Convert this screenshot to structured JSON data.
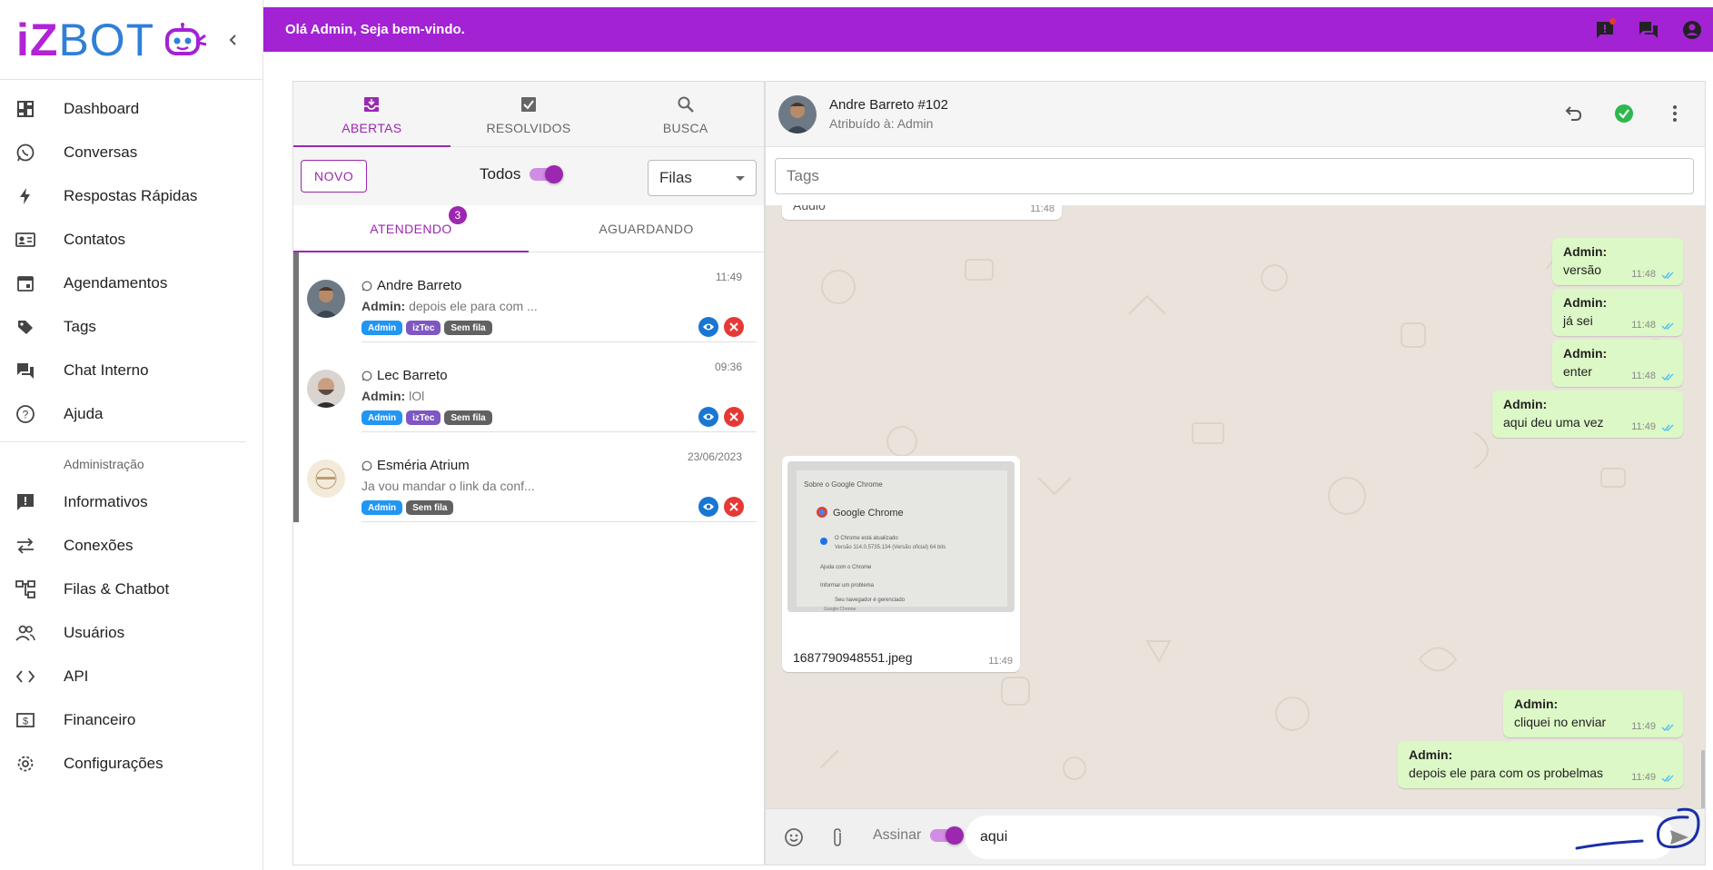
{
  "brand": {
    "part1": "iZ",
    "part2": "BOT"
  },
  "sidebar": {
    "items": [
      {
        "label": "Dashboard",
        "icon": "dashboard-icon"
      },
      {
        "label": "Conversas",
        "icon": "whatsapp-icon"
      },
      {
        "label": "Respostas Rápidas",
        "icon": "bolt-icon"
      },
      {
        "label": "Contatos",
        "icon": "contacts-icon"
      },
      {
        "label": "Agendamentos",
        "icon": "calendar-icon"
      },
      {
        "label": "Tags",
        "icon": "tag-icon"
      },
      {
        "label": "Chat Interno",
        "icon": "forum-icon"
      },
      {
        "label": "Ajuda",
        "icon": "help-icon"
      }
    ],
    "section_label": "Administração",
    "admin_items": [
      {
        "label": "Informativos",
        "icon": "announcement-icon"
      },
      {
        "label": "Conexões",
        "icon": "swap-icon"
      },
      {
        "label": "Filas & Chatbot",
        "icon": "account-tree-icon"
      },
      {
        "label": "Usuários",
        "icon": "people-icon"
      },
      {
        "label": "API",
        "icon": "code-icon"
      },
      {
        "label": "Financeiro",
        "icon": "money-icon"
      },
      {
        "label": "Configurações",
        "icon": "settings-icon"
      }
    ]
  },
  "topbar": {
    "welcome": "Olá Admin, Seja bem-vindo."
  },
  "tickets": {
    "tabs": [
      {
        "label": "ABERTAS",
        "icon": "inbox-icon"
      },
      {
        "label": "RESOLVIDOS",
        "icon": "check-box-icon"
      },
      {
        "label": "BUSCA",
        "icon": "search-icon"
      }
    ],
    "new_button": "NOVO",
    "todos_label": "Todos",
    "queue_select": "Filas",
    "subtabs": [
      "ATENDENDO",
      "AGUARDANDO"
    ],
    "badge_count": "3",
    "list": [
      {
        "name": "Andre Barreto",
        "author": "Admin:",
        "message": "depois ele para com ...",
        "time": "11:49",
        "chips": [
          "Admin",
          "izTec",
          "Sem fila"
        ]
      },
      {
        "name": "Lec Barreto",
        "author": "Admin:",
        "message": "lOl",
        "time": "09:36",
        "chips": [
          "Admin",
          "izTec",
          "Sem fila"
        ]
      },
      {
        "name": "Esméria Atrium",
        "author": "",
        "message": "Ja vou mandar o link da conf...",
        "time": "23/06/2023",
        "chips": [
          "Admin",
          "Sem fila"
        ]
      }
    ]
  },
  "chat": {
    "contact": "Andre Barreto #102",
    "assigned": "Atribuído à: Admin",
    "tags_placeholder": "Tags",
    "partial_in": {
      "text": "Áudio",
      "time": "11:48"
    },
    "outgoing": [
      {
        "author": "Admin:",
        "text": "versão",
        "time": "11:48"
      },
      {
        "author": "Admin:",
        "text": "já sei",
        "time": "11:48"
      },
      {
        "author": "Admin:",
        "text": "enter",
        "time": "11:48"
      },
      {
        "author": "Admin:",
        "text": "aqui deu uma vez",
        "time": "11:49"
      },
      {
        "author": "Admin:",
        "text": "cliquei no enviar",
        "time": "11:49"
      },
      {
        "author": "Admin:",
        "text": "depois ele para com os probelmas",
        "time": "11:49"
      }
    ],
    "image_msg": {
      "filename": "1687790948551.jpeg",
      "time": "11:49",
      "screen_title": "Sobre o Google Chrome",
      "screen_app": "Google Chrome",
      "screen_line1": "O Chrome está atualizado",
      "screen_line2": "Versão 114.0.5735.134 (Versão oficial) 64 bits",
      "screen_line3": "Ajuda com o Chrome",
      "screen_line4": "Informar um problema",
      "screen_line5": "Seu navegador é gerenciado",
      "screen_line6": "Google Chrome"
    },
    "signature_label": "Assinar",
    "input_value": "aqui"
  },
  "colors": {
    "primary": "#a322d4",
    "chip_admin": "#2196f3",
    "chip_iztec": "#7e57c2",
    "chip_nofila": "#616161",
    "out_bubble": "#dcf8c6"
  }
}
